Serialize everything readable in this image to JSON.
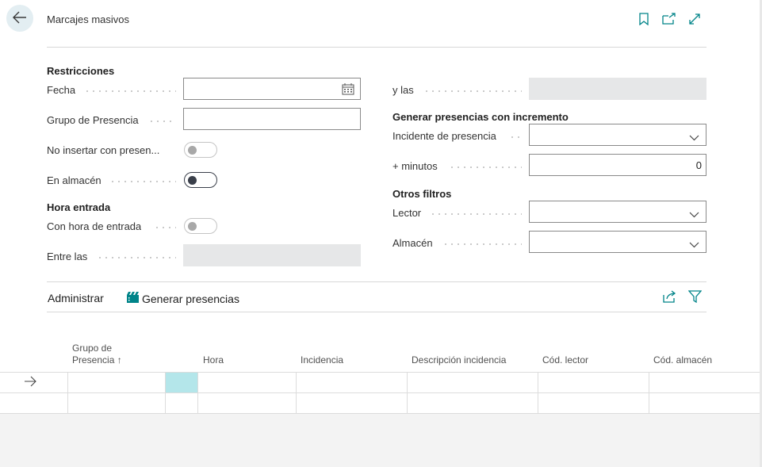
{
  "header": {
    "title": "Marcajes masivos",
    "back_icon": "arrow-left-icon",
    "actions": [
      "bookmark-icon",
      "open-new-window-icon",
      "expand-icon"
    ]
  },
  "restricciones": {
    "title": "Restricciones",
    "fecha_label": "Fecha",
    "fecha_value": "",
    "grupo_label": "Grupo de Presencia",
    "grupo_value": "",
    "no_insertar_label": "No insertar con presen...",
    "no_insertar_on": false,
    "en_almacen_label": "En almacén",
    "en_almacen_on": true
  },
  "hora_entrada": {
    "title": "Hora entrada",
    "con_hora_label": "Con hora de entrada",
    "con_hora_on": false,
    "entre_label": "Entre las",
    "entre_value": ""
  },
  "right_panel": {
    "y_las_label": "y las",
    "y_las_value": "",
    "generar_title": "Generar presencias con incremento",
    "incidente_label": "Incidente de presencia",
    "incidente_value": "",
    "minutos_label": "+ minutos",
    "minutos_value": "0",
    "otros_title": "Otros filtros",
    "lector_label": "Lector",
    "lector_value": "",
    "almacen_label": "Almacén",
    "almacen_value": ""
  },
  "actions_bar": {
    "administrar": "Administrar",
    "generar": "Generar presencias",
    "icons": [
      "share-icon",
      "filter-icon"
    ]
  },
  "table": {
    "columns": {
      "grupo_line1": "Grupo de",
      "grupo_line2": "Presencia ↑",
      "hora": "Hora",
      "incidencia": "Incidencia",
      "descripcion": "Descripción incidencia",
      "lector": "Cód. lector",
      "almacen": "Cód. almacén"
    },
    "rows": [
      {
        "grupo": "",
        "hora": "",
        "incidencia": "",
        "descripcion": "",
        "lector": "",
        "almacen": ""
      },
      {
        "grupo": "",
        "hora": "",
        "incidencia": "",
        "descripcion": "",
        "lector": "",
        "almacen": ""
      }
    ]
  },
  "colors": {
    "accent": "#008489",
    "selected_cell": "#b4e6ea",
    "disabled_field": "#e6e7e8"
  }
}
